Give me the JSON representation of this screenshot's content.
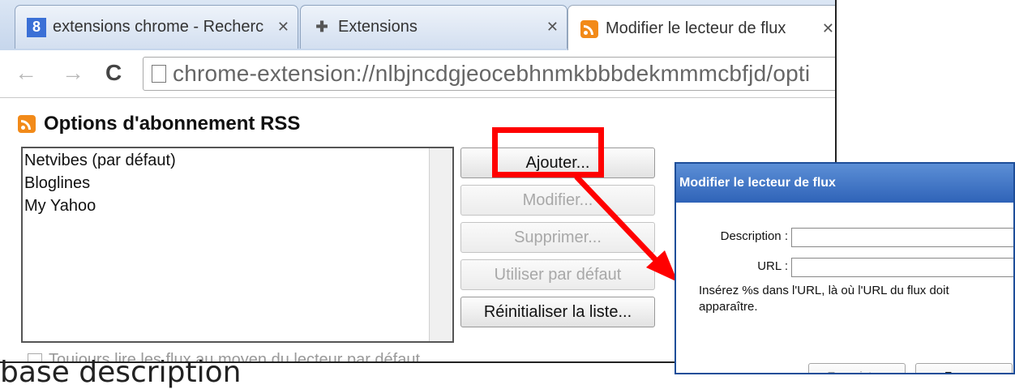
{
  "browser": {
    "tabs": [
      {
        "title": "extensions chrome - Recherc",
        "icon": "google-icon"
      },
      {
        "title": "Extensions",
        "icon": "puzzle-icon"
      },
      {
        "title": "Modifier le lecteur de flux",
        "icon": "rss-icon",
        "active": true
      }
    ],
    "address": "chrome-extension://nlbjncdgjeocebhnmkbbbdekmmmcbfjd/opti"
  },
  "page": {
    "heading": "Options d'abonnement RSS",
    "readers": [
      "Netvibes (par défaut)",
      "Bloglines",
      "My Yahoo"
    ],
    "buttons": {
      "add": "Ajouter...",
      "edit": "Modifier...",
      "remove": "Supprimer...",
      "default": "Utiliser par défaut",
      "reset": "Réinitialiser la liste..."
    },
    "checkbox_label": "Toujours lire les flux au moyen du lecteur par défaut"
  },
  "dialog": {
    "title": "Modifier le lecteur de flux",
    "description_label": "Description :",
    "url_label": "URL :",
    "note": "Insérez %s dans l'URL, là où l'URL du flux doit apparaître.",
    "save": "Enregistrer",
    "close": "Fermer"
  },
  "overlay": {
    "caption": "base description"
  },
  "colors": {
    "annotation": "#ff0000",
    "dialog_title": "#2f63b8",
    "rss": "#f28a19"
  }
}
